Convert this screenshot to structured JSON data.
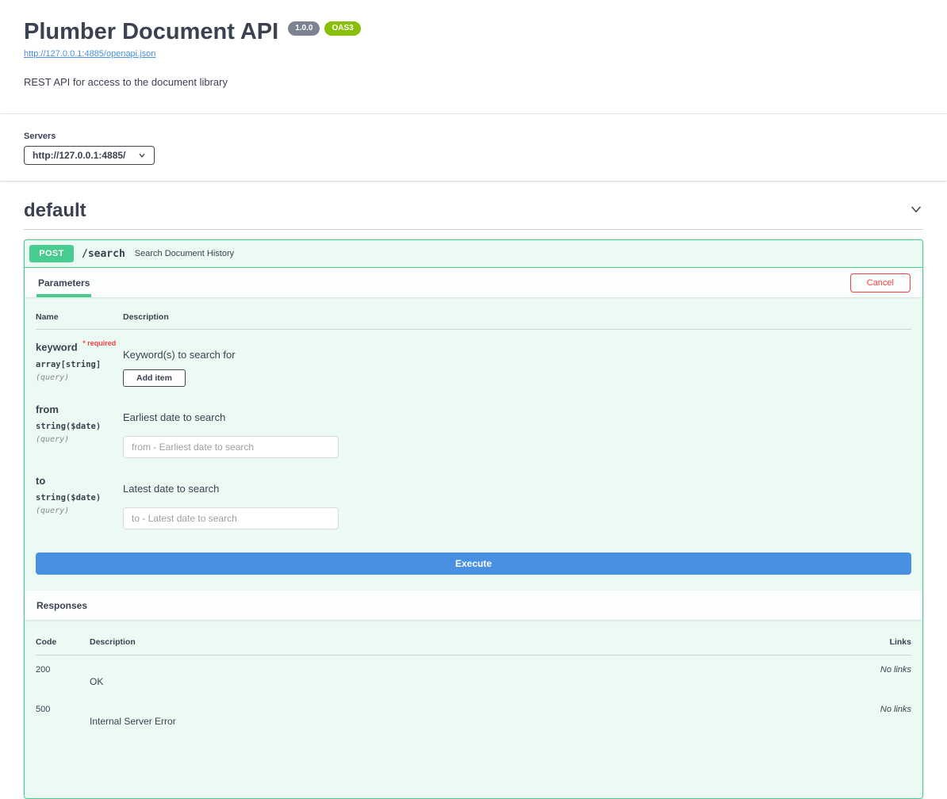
{
  "colors": {
    "post_green": "#49cc90",
    "opblock_tint": "#edf8f3",
    "execute_blue": "#4990e2",
    "cancel_red": "#f93e3e",
    "version_badge_gray": "#7d8293",
    "oas_badge_green": "#89bf04",
    "link_blue": "#4990e2",
    "text_primary": "#3b4151"
  },
  "info": {
    "title": "Plumber Document API",
    "version": "1.0.0",
    "oas": "OAS3",
    "spec_url": "http://127.0.0.1:4885/openapi.json",
    "description": "REST API for access to the document library"
  },
  "servers": {
    "label": "Servers",
    "selected": "http://127.0.0.1:4885/"
  },
  "tag": {
    "name": "default"
  },
  "operation": {
    "method": "POST",
    "path": "/search",
    "summary": "Search Document History",
    "tabs": {
      "parameters": "Parameters"
    },
    "cancel_label": "Cancel",
    "param_table": {
      "name_header": "Name",
      "description_header": "Description"
    },
    "params": [
      {
        "name": "keyword",
        "required_label": "* required",
        "type": "array[string]",
        "location": "(query)",
        "description": "Keyword(s) to search for",
        "add_item_label": "Add item"
      },
      {
        "name": "from",
        "type": "string($date)",
        "location": "(query)",
        "description": "Earliest date to search",
        "placeholder": "from - Earliest date to search"
      },
      {
        "name": "to",
        "type": "string($date)",
        "location": "(query)",
        "description": "Latest date to search",
        "placeholder": "to - Latest date to search"
      }
    ],
    "execute_label": "Execute",
    "responses": {
      "title": "Responses",
      "headers": {
        "code": "Code",
        "description": "Description",
        "links": "Links"
      },
      "rows": [
        {
          "code": "200",
          "description": "OK",
          "links": "No links"
        },
        {
          "code": "500",
          "description": "Internal Server Error",
          "links": "No links"
        }
      ]
    }
  }
}
